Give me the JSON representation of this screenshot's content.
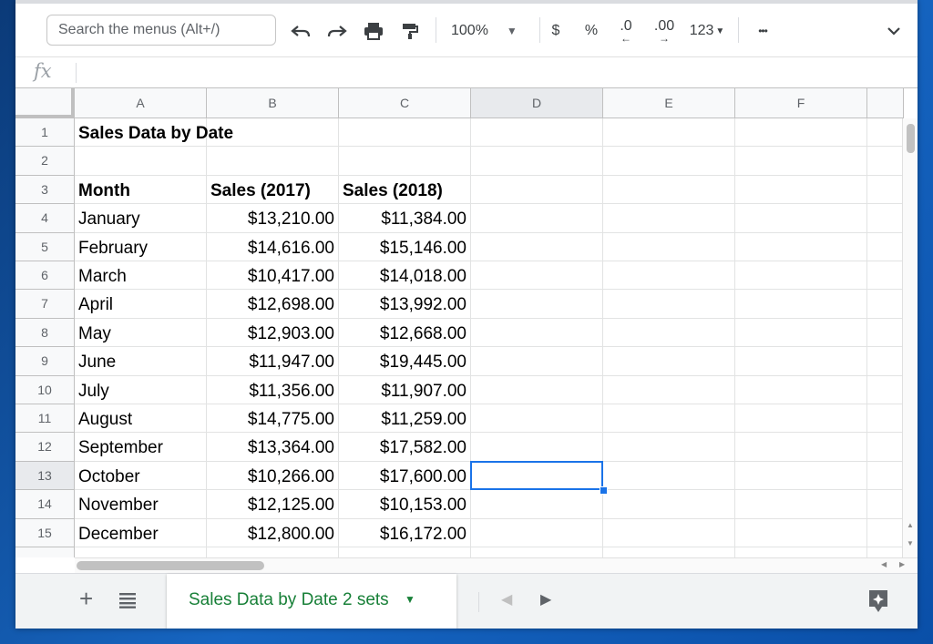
{
  "toolbar": {
    "search_placeholder": "Search the menus (Alt+/)",
    "zoom": "100%",
    "currency": "$",
    "percent": "%",
    "dec_decrease": ".0",
    "dec_increase": ".00",
    "more_formats": "123",
    "more": "•••"
  },
  "formula_bar": {
    "fx": "fx",
    "value": ""
  },
  "columns": [
    "A",
    "B",
    "C",
    "D",
    "E",
    "F"
  ],
  "rows": [
    "1",
    "2",
    "3",
    "4",
    "5",
    "6",
    "7",
    "8",
    "9",
    "10",
    "11",
    "12",
    "13",
    "14",
    "15"
  ],
  "sheet": {
    "title": "Sales Data by Date",
    "headers": {
      "month": "Month",
      "sales_2017": "Sales (2017)",
      "sales_2018": "Sales (2018)"
    },
    "data": [
      {
        "month": "January",
        "s2017": "$13,210.00",
        "s2018": "$11,384.00"
      },
      {
        "month": "February",
        "s2017": "$14,616.00",
        "s2018": "$15,146.00"
      },
      {
        "month": "March",
        "s2017": "$10,417.00",
        "s2018": "$14,018.00"
      },
      {
        "month": "April",
        "s2017": "$12,698.00",
        "s2018": "$13,992.00"
      },
      {
        "month": "May",
        "s2017": "$12,903.00",
        "s2018": "$12,668.00"
      },
      {
        "month": "June",
        "s2017": "$11,947.00",
        "s2018": "$19,445.00"
      },
      {
        "month": "July",
        "s2017": "$11,356.00",
        "s2018": "$11,907.00"
      },
      {
        "month": "August",
        "s2017": "$14,775.00",
        "s2018": "$11,259.00"
      },
      {
        "month": "September",
        "s2017": "$13,364.00",
        "s2018": "$17,582.00"
      },
      {
        "month": "October",
        "s2017": "$10,266.00",
        "s2018": "$17,600.00"
      },
      {
        "month": "November",
        "s2017": "$12,125.00",
        "s2018": "$10,153.00"
      },
      {
        "month": "December",
        "s2017": "$12,800.00",
        "s2018": "$16,172.00"
      }
    ]
  },
  "selected_cell": {
    "column": "D",
    "row": "13"
  },
  "sheet_tabs": [
    {
      "label": "Sales Data by Date 2 sets",
      "active": true
    }
  ],
  "colors": {
    "accent": "#1a73e8",
    "tab_text": "#188038"
  }
}
